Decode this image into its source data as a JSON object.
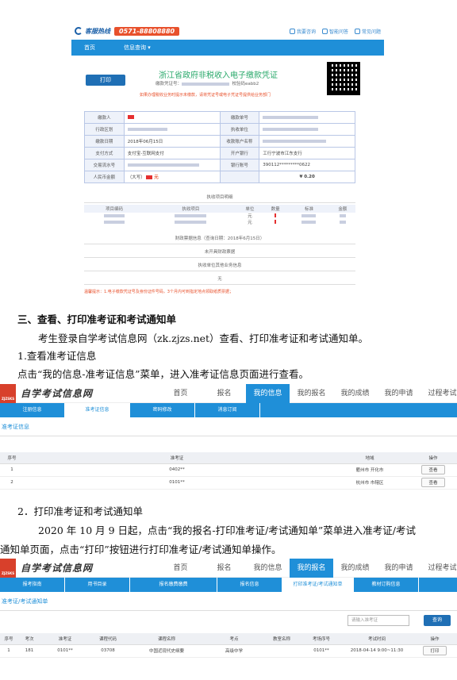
{
  "receipt": {
    "hotline_label": "客服热线",
    "hotline_number": "0571-88808880",
    "top_links": [
      "我要咨询",
      "智能问答",
      "常见问题"
    ],
    "nav": [
      "首页",
      "信息查询 ▾"
    ],
    "print_button": "打印",
    "title": "浙江省政府非税收入电子缴款凭证",
    "sub_left": "缴款凭证号：",
    "sub_right": "校验码eabb2",
    "warn": "如果办理税收业务时提示未缴款，请将凭证号或电子凭证号提供给业务部门",
    "rows": [
      {
        "k1": "缴款人",
        "v1": "",
        "k2": "缴款单号",
        "v2": ""
      },
      {
        "k1": "行政区划",
        "v1": "",
        "k2": "执收单位",
        "v2": ""
      },
      {
        "k1": "缴款日期",
        "v1": "2018年06月15日",
        "k2": "收款账户名称",
        "v2": ""
      },
      {
        "k1": "支付方式",
        "v1": "支付宝-互联网支付",
        "k2": "开户银行",
        "v2": "工行宁波市江东支行"
      },
      {
        "k1": "交易流水号",
        "v1": "",
        "k2": "银行账号",
        "v2": "390112*********0622"
      },
      {
        "k1": "人民币金额",
        "v1": "（大写）",
        "v1b": "元",
        "k2": "",
        "v2": "¥ 0.20"
      }
    ],
    "items_title": "执收项目明细",
    "items_headers": [
      "项目编码",
      "执收项目",
      "单位",
      "数量",
      "标准",
      "金额"
    ],
    "items_rows": [
      [
        "",
        "",
        "元",
        "",
        "",
        ""
      ],
      [
        "",
        "",
        "元",
        "",
        "",
        ""
      ]
    ],
    "finance_info": "财政票据信息（查询日期：2018年6月15日）",
    "no_invoice": "未开具财政票据",
    "unit_info": "执收单位其他业务信息",
    "none": "无",
    "notice": "温馨提示：1.电子缴款凭证号及身份证件号码，3个月内可到指定地点领取纸质票据；"
  },
  "section": {
    "heading": "三、查看、打印准考证和考试通知单",
    "intro": "考生登录自学考试信息网（zk.zjzs.net）查看、打印准考证和考试通知单。",
    "step1_title": "1.查看准考证信息",
    "step1_desc": "点击“我的信息-准考证信息”菜单，进入准考证信息页面进行查看。",
    "step2_title": "2．打印准考证和考试通知单",
    "step2_desc_1": "2020 年 10 月 9 日起，点击“我的报名-打印准考证/考试通知单”菜单进入准考证/考试",
    "step2_desc_2": "通知单页面，点击“打印”按钮进行打印准考证/考试通知单操作。"
  },
  "portal1": {
    "logo_text": "ZJZSKS",
    "site_name": "自学考试信息网",
    "nav": [
      "首页",
      "报名",
      "我的信息",
      "我的报名",
      "我的成绩",
      "我的申请",
      "过程考试"
    ],
    "active_index": 2,
    "subnav": [
      "注册信息",
      "准考证信息",
      "密码修改",
      "消息订阅"
    ],
    "sub_selected": 1,
    "section_title": "准考证信息",
    "headers": [
      "序号",
      "准考证",
      "地域",
      "操作"
    ],
    "rows": [
      {
        "no": "1",
        "id": "0402**",
        "region": "衢州市 开化市",
        "action": "查看"
      },
      {
        "no": "2",
        "id": "0101**",
        "region": "杭州市 市辖区",
        "action": "查看"
      }
    ]
  },
  "portal2": {
    "logo_text": "ZJZSKS",
    "site_name": "自学考试信息网",
    "nav": [
      "首页",
      "报名",
      "我的信息",
      "我的报名",
      "我的成绩",
      "我的申请",
      "过程考试"
    ],
    "active_index": 3,
    "subnav": [
      "报考指南",
      "用书目录",
      "报名缴费缴费",
      "报名信息",
      "打印准考证/考试通知单",
      "教材订购信息"
    ],
    "sub_selected": 4,
    "section_title": "准考证/考试通知单",
    "search_placeholder": "请输入准考证",
    "search_button": "查询",
    "headers": [
      "序号",
      "考次",
      "准考证",
      "课程代码",
      "课程名称",
      "考点",
      "教室名称",
      "考场序号",
      "考试时间",
      "操作"
    ],
    "rows": [
      {
        "no": "1",
        "term": "181",
        "id": "0101**",
        "code": "03708",
        "course": "中国近现代史纲要",
        "site": "高级中学",
        "room": "",
        "seat": "0101**",
        "time": "2018-04-14 9:00~11:30",
        "action": "打印"
      }
    ]
  }
}
